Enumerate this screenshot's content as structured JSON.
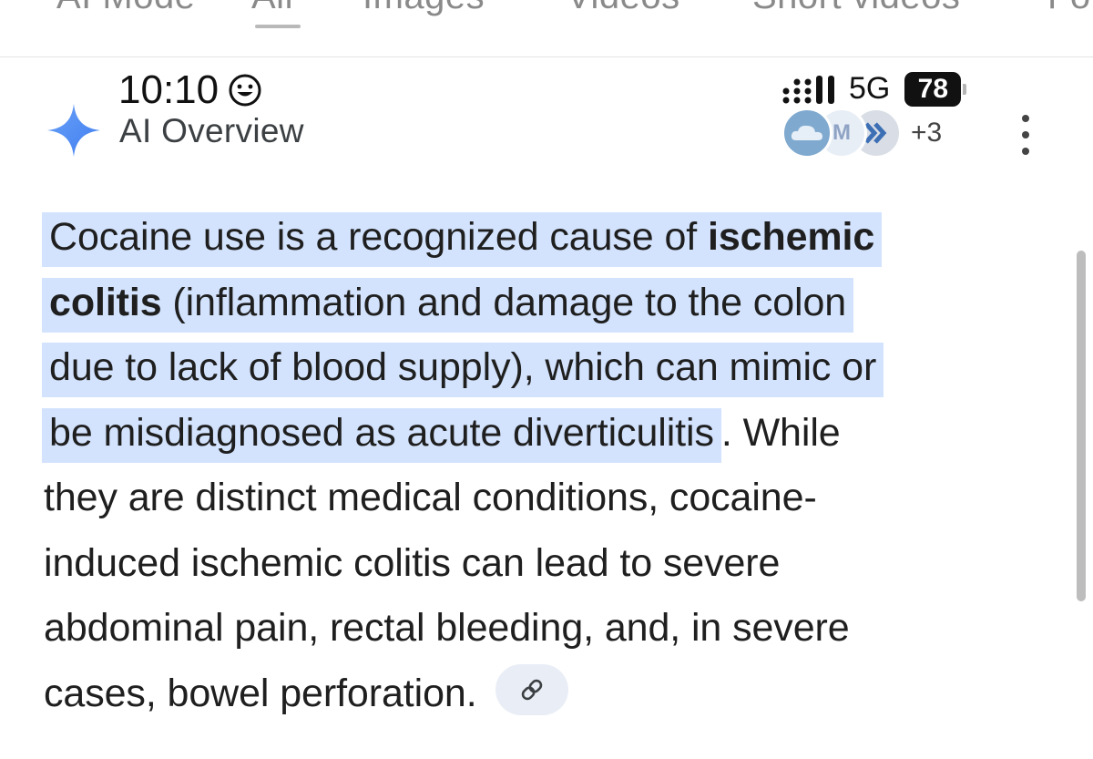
{
  "tabs": {
    "items": [
      "AI Mode",
      "All",
      "Images",
      "Videos",
      "Short videos",
      "Forums"
    ]
  },
  "status_bar": {
    "time": "10:10",
    "network": "5G",
    "battery": "78"
  },
  "overview": {
    "title": "AI Overview",
    "sources_more": "+3"
  },
  "answer": {
    "hl_line1_a": "Cocaine use is a recognized cause of ",
    "hl_line1_b": "ischemic",
    "hl_line2_a": "colitis",
    "hl_line2_b": " (inflammation and damage to the colon",
    "hl_line3": "due to lack of blood supply), which can mimic or",
    "hl_line4": "be misdiagnosed as acute diverticulitis",
    "line4_rest": ". While",
    "line5": "they are distinct medical conditions, cocaine-",
    "line6": "induced ischemic colitis can lead to severe",
    "line7": "abdominal pain, rectal bleeding, and, in severe",
    "line8": "cases, bowel perforation."
  },
  "colors": {
    "highlight": "#d3e3fd",
    "text": "#1f1f1f",
    "sparkle_blue": "#4f8df5"
  },
  "icons": {
    "emoji": "smiley-icon",
    "signal": "signal-icon",
    "sparkle": "sparkle-icon",
    "link": "link-icon",
    "menu": "more-vert-icon"
  }
}
